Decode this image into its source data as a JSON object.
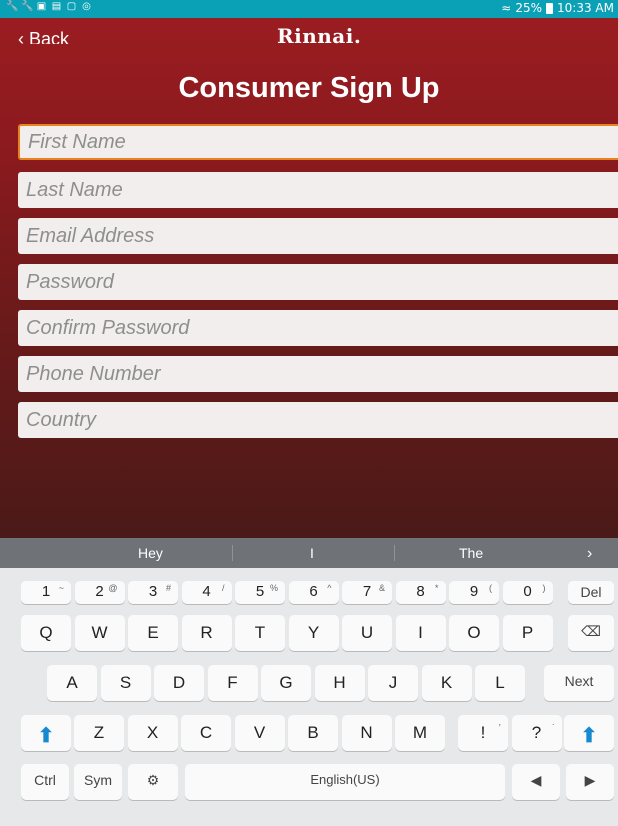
{
  "status_bar": {
    "left_icons": [
      "wrench-icon",
      "wrench-icon",
      "message-icon",
      "image-icon",
      "phone-icon",
      "target-icon"
    ],
    "battery": "25%",
    "time": "10:33 AM"
  },
  "header": {
    "back_label": "Back",
    "logo": "Rinnai."
  },
  "page_title": "Consumer Sign Up",
  "fields": [
    {
      "placeholder": "First Name"
    },
    {
      "placeholder": "Last Name"
    },
    {
      "placeholder": "Email Address"
    },
    {
      "placeholder": "Password"
    },
    {
      "placeholder": "Confirm Password"
    },
    {
      "placeholder": "Phone Number"
    },
    {
      "placeholder": "Country"
    }
  ],
  "keyboard": {
    "suggestions": [
      "Hey",
      "I",
      "The"
    ],
    "row1": [
      {
        "k": "1",
        "s": "~"
      },
      {
        "k": "2",
        "s": "@"
      },
      {
        "k": "3",
        "s": "#"
      },
      {
        "k": "4",
        "s": "/"
      },
      {
        "k": "5",
        "s": "%"
      },
      {
        "k": "6",
        "s": "^"
      },
      {
        "k": "7",
        "s": "&"
      },
      {
        "k": "8",
        "s": "*"
      },
      {
        "k": "9",
        "s": "("
      },
      {
        "k": "0",
        "s": ")"
      }
    ],
    "del": "Del",
    "row2": [
      "Q",
      "W",
      "E",
      "R",
      "T",
      "Y",
      "U",
      "I",
      "O",
      "P"
    ],
    "row3": [
      "A",
      "S",
      "D",
      "F",
      "G",
      "H",
      "J",
      "K",
      "L"
    ],
    "next": "Next",
    "row4": [
      "Z",
      "X",
      "C",
      "V",
      "B",
      "N",
      "M"
    ],
    "row4_punct": [
      {
        "k": "!",
        "s": ","
      },
      {
        "k": "?",
        "s": "."
      }
    ],
    "ctrl": "Ctrl",
    "sym": "Sym",
    "space": "English(US)"
  }
}
